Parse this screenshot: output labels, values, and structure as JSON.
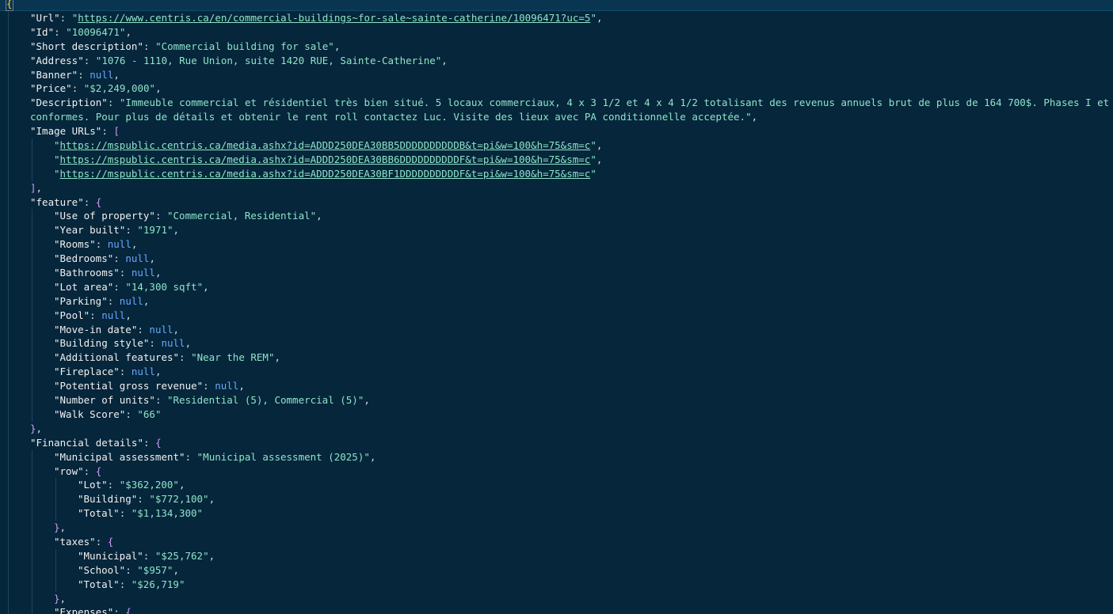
{
  "editor": {
    "first_line": "{",
    "lines": [
      {
        "i": 1,
        "k": "Url",
        "t": "url",
        "v": "https://www.centris.ca/en/commercial-buildings~for-sale~sainte-catherine/10096471?uc=5",
        "e": ","
      },
      {
        "i": 1,
        "k": "Id",
        "t": "str",
        "v": "10096471",
        "e": ","
      },
      {
        "i": 1,
        "k": "Short description",
        "t": "str",
        "v": "Commercial building for sale",
        "e": ","
      },
      {
        "i": 1,
        "k": "Address",
        "t": "str",
        "v": "1076 - 1110, Rue Union, suite 1420 RUE, Sainte-Catherine",
        "e": ","
      },
      {
        "i": 1,
        "k": "Banner",
        "t": "null",
        "v": "null",
        "e": ","
      },
      {
        "i": 1,
        "k": "Price",
        "t": "str",
        "v": "$2,249,000",
        "e": ","
      },
      {
        "i": 1,
        "k": "Description",
        "t": "str",
        "v": "Immeuble commercial et résidentiel très bien situé. 5 locaux commerciaux, 4 x 3 1/2 et 4 x 4 1/2 totalisant des revenus annuels brut de plus de 164 700$. Phases I et II",
        "e": "",
        "noclose": true
      },
      {
        "i": 1,
        "t": "cont",
        "v": "conformes. Pour plus de détails et obtenir le rent roll contactez Luc. Visite des lieux avec PA conditionnelle acceptée.",
        "e": ","
      },
      {
        "i": 1,
        "k": "Image URLs",
        "t": "open",
        "v": "[",
        "e": ""
      },
      {
        "i": 2,
        "t": "urlitem",
        "v": "https://mspublic.centris.ca/media.ashx?id=ADDD250DEA30BB5DDDDDDDDDDB&t=pi&w=100&h=75&sm=c",
        "e": ","
      },
      {
        "i": 2,
        "t": "urlitem",
        "v": "https://mspublic.centris.ca/media.ashx?id=ADDD250DEA30BB6DDDDDDDDDDF&t=pi&w=100&h=75&sm=c",
        "e": ","
      },
      {
        "i": 2,
        "t": "urlitem",
        "v": "https://mspublic.centris.ca/media.ashx?id=ADDD250DEA30BF1DDDDDDDDDDF&t=pi&w=100&h=75&sm=c",
        "e": ""
      },
      {
        "i": 1,
        "t": "close",
        "v": "]",
        "e": ","
      },
      {
        "i": 1,
        "k": "feature",
        "t": "open",
        "v": "{",
        "e": ""
      },
      {
        "i": 2,
        "k": "Use of property",
        "t": "str",
        "v": "Commercial, Residential",
        "e": ","
      },
      {
        "i": 2,
        "k": "Year built",
        "t": "str",
        "v": "1971",
        "e": ","
      },
      {
        "i": 2,
        "k": "Rooms",
        "t": "null",
        "v": "null",
        "e": ","
      },
      {
        "i": 2,
        "k": "Bedrooms",
        "t": "null",
        "v": "null",
        "e": ","
      },
      {
        "i": 2,
        "k": "Bathrooms",
        "t": "null",
        "v": "null",
        "e": ","
      },
      {
        "i": 2,
        "k": "Lot area",
        "t": "str",
        "v": "14,300 sqft",
        "e": ","
      },
      {
        "i": 2,
        "k": "Parking",
        "t": "null",
        "v": "null",
        "e": ","
      },
      {
        "i": 2,
        "k": "Pool",
        "t": "null",
        "v": "null",
        "e": ","
      },
      {
        "i": 2,
        "k": "Move-in date",
        "t": "null",
        "v": "null",
        "e": ","
      },
      {
        "i": 2,
        "k": "Building style",
        "t": "null",
        "v": "null",
        "e": ","
      },
      {
        "i": 2,
        "k": "Additional features",
        "t": "str",
        "v": "Near the REM",
        "e": ","
      },
      {
        "i": 2,
        "k": "Fireplace",
        "t": "null",
        "v": "null",
        "e": ","
      },
      {
        "i": 2,
        "k": "Potential gross revenue",
        "t": "null",
        "v": "null",
        "e": ","
      },
      {
        "i": 2,
        "k": "Number of units",
        "t": "str",
        "v": "Residential (5), Commercial (5)",
        "e": ","
      },
      {
        "i": 2,
        "k": "Walk Score",
        "t": "str",
        "v": "66",
        "e": ""
      },
      {
        "i": 1,
        "t": "close",
        "v": "}",
        "e": ","
      },
      {
        "i": 1,
        "k": "Financial details",
        "t": "open",
        "v": "{",
        "e": ""
      },
      {
        "i": 2,
        "k": "Municipal assessment",
        "t": "str",
        "v": "Municipal assessment (2025)",
        "e": ","
      },
      {
        "i": 2,
        "k": "row",
        "t": "open",
        "v": "{",
        "e": ""
      },
      {
        "i": 3,
        "k": "Lot",
        "t": "str",
        "v": "$362,200",
        "e": ","
      },
      {
        "i": 3,
        "k": "Building",
        "t": "str",
        "v": "$772,100",
        "e": ","
      },
      {
        "i": 3,
        "k": "Total",
        "t": "str",
        "v": "$1,134,300",
        "e": ""
      },
      {
        "i": 2,
        "t": "close",
        "v": "}",
        "e": ","
      },
      {
        "i": 2,
        "k": "taxes",
        "t": "open",
        "v": "{",
        "e": ""
      },
      {
        "i": 3,
        "k": "Municipal",
        "t": "str",
        "v": "$25,762",
        "e": ","
      },
      {
        "i": 3,
        "k": "School",
        "t": "str",
        "v": "$957",
        "e": ","
      },
      {
        "i": 3,
        "k": "Total",
        "t": "str",
        "v": "$26,719",
        "e": ""
      },
      {
        "i": 2,
        "t": "close",
        "v": "}",
        "e": ","
      },
      {
        "i": 2,
        "k": "Expenses",
        "t": "open",
        "v": "{",
        "e": ""
      }
    ]
  },
  "colors": {
    "background": "#05263b",
    "key": "#f1f1f1",
    "string": "#8fe3c8",
    "null": "#6aa7ff",
    "brace": "#d39af5"
  }
}
